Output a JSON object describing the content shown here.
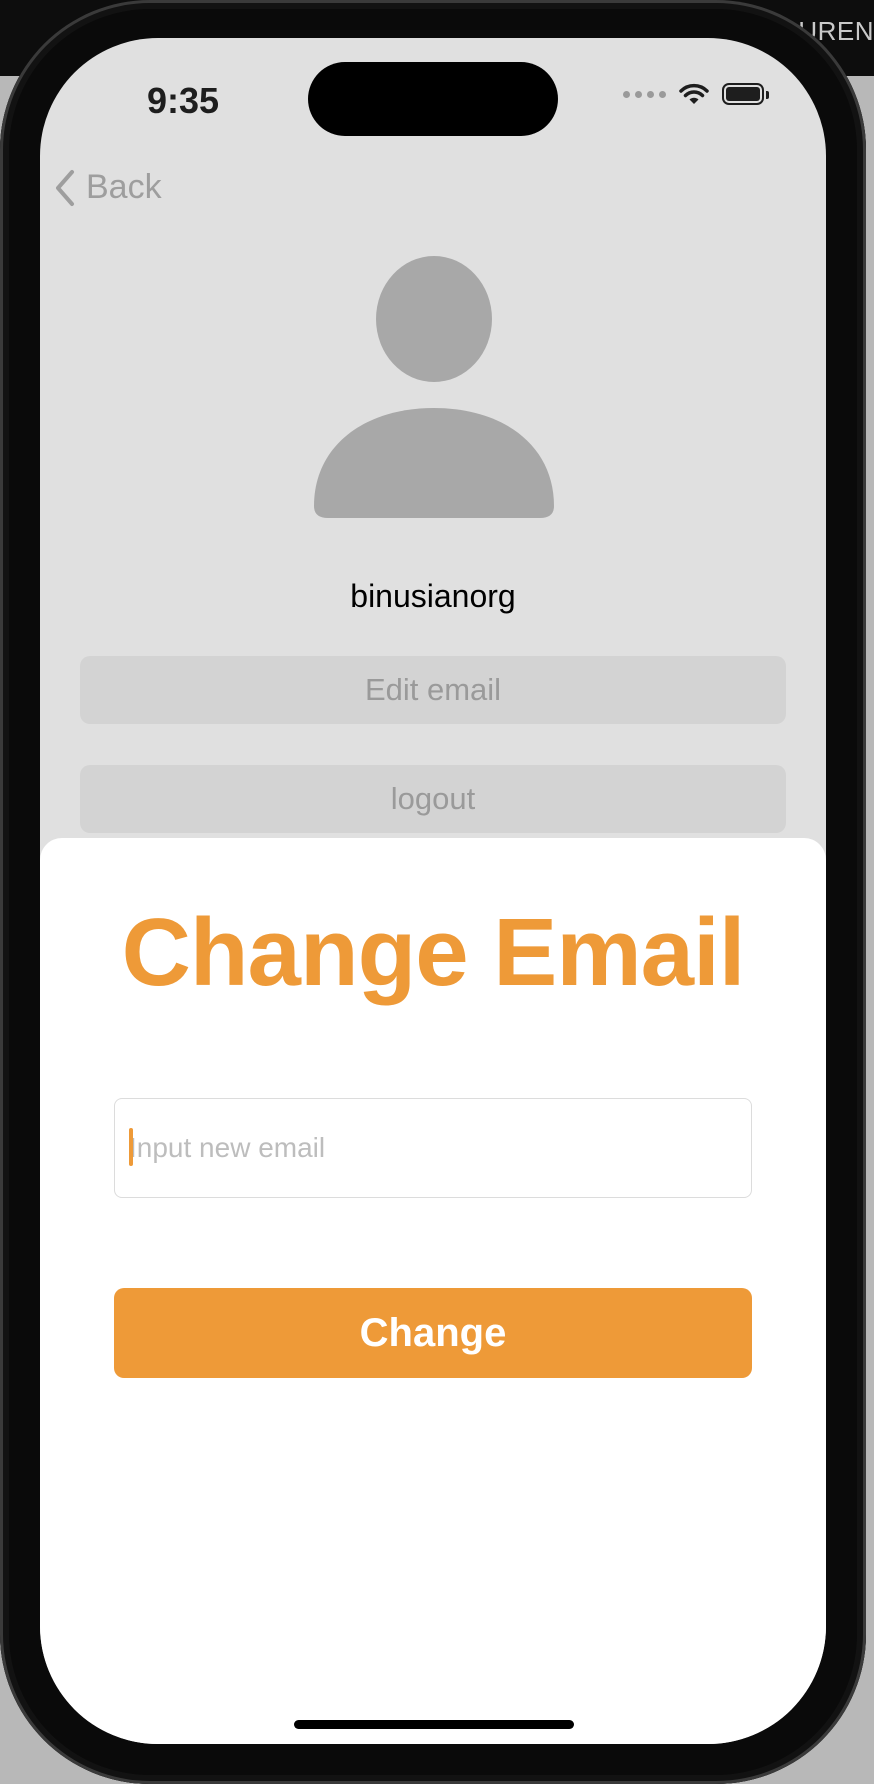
{
  "host": {
    "window_text": "LAUREN"
  },
  "status_bar": {
    "time": "9:35"
  },
  "nav": {
    "back_label": "Back"
  },
  "profile": {
    "username": "binusianorg"
  },
  "buttons": {
    "edit_email": "Edit email",
    "logout": "logout"
  },
  "sheet": {
    "title": "Change Email",
    "email_placeholder": "Input new email",
    "email_value": "",
    "submit_label": "Change"
  },
  "colors": {
    "accent": "#ee9a38",
    "background": "#e0e0e0",
    "sheet": "#ffffff"
  },
  "icons": [
    "back-chevron-icon",
    "person-icon",
    "wifi-icon",
    "battery-icon",
    "cellular-icon"
  ]
}
